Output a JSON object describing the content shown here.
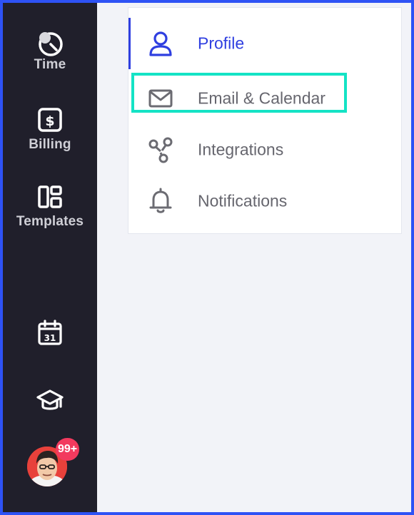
{
  "sidebar": {
    "items": [
      {
        "label": "Time",
        "icon": "stopwatch-icon"
      },
      {
        "label": "Billing",
        "icon": "dollar-document-icon"
      },
      {
        "label": "Templates",
        "icon": "layout-template-icon"
      }
    ],
    "bottom": [
      {
        "icon": "calendar-icon",
        "text": "31"
      },
      {
        "icon": "graduation-cap-icon"
      }
    ],
    "user": {
      "badge": "99+"
    }
  },
  "menu": {
    "items": [
      {
        "label": "Profile",
        "icon": "user-icon",
        "active": true
      },
      {
        "label": "Email & Calendar",
        "icon": "mail-icon",
        "highlighted": true
      },
      {
        "label": "Integrations",
        "icon": "integrations-icon"
      },
      {
        "label": "Notifications",
        "icon": "bell-icon"
      }
    ]
  },
  "colors": {
    "sidebar_bg": "#201f2b",
    "accent": "#2f3fe0",
    "highlight": "#14e3c5",
    "badge": "#f23a5e",
    "content_bg": "#f2f3f8",
    "frame": "#2e52f5"
  }
}
